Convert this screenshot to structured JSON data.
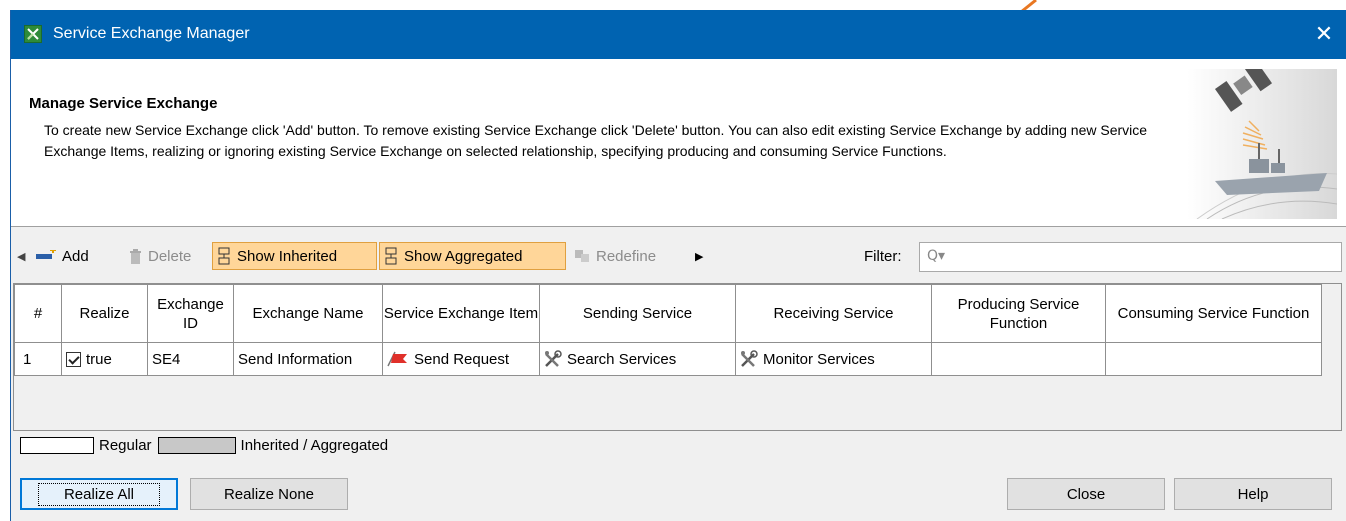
{
  "window": {
    "title": "Service Exchange Manager",
    "close_glyph": "✕"
  },
  "header": {
    "title": "Manage Service Exchange",
    "description": "To create new Service Exchange click 'Add' button. To remove existing Service Exchange click 'Delete' button. You can also edit existing Service Exchange by adding new Service Exchange Items, realizing or ignoring existing Service Exchange on selected relationship, specifying producing and consuming Service Functions.",
    "image": "satellite-ship-illustration"
  },
  "toolbar": {
    "scroll_left": "◀",
    "add": "Add",
    "delete": "Delete",
    "show_inherited": "Show Inherited",
    "show_aggregated": "Show Aggregated",
    "redefine": "Redefine",
    "scroll_right": "▶",
    "filter_label": "Filter:",
    "filter_value": ""
  },
  "table": {
    "columns": [
      "#",
      "Realize",
      "Exchange ID",
      "Exchange Name",
      "Service Exchange Item",
      "Sending Service",
      "Receiving Service",
      "Producing Service Function",
      "Consuming Service Function"
    ],
    "rows": [
      {
        "num": "1",
        "realize_checked": true,
        "realize": "true",
        "exchange_id": "SE4",
        "exchange_name": "Send Information",
        "item": "Send Request",
        "sending": "Search Services",
        "receiving": "Monitor Services",
        "producing": "",
        "consuming": ""
      }
    ]
  },
  "legend": {
    "regular": "Regular",
    "inherited": "Inherited / Aggregated"
  },
  "buttons": {
    "realize_all": "Realize All",
    "realize_none": "Realize None",
    "close": "Close",
    "help": "Help"
  },
  "colors": {
    "titlebar": "#0063b1",
    "toggle_bg": "#ffd699",
    "arrow": "#e87722",
    "legend_inherited": "#c8c8c8"
  }
}
